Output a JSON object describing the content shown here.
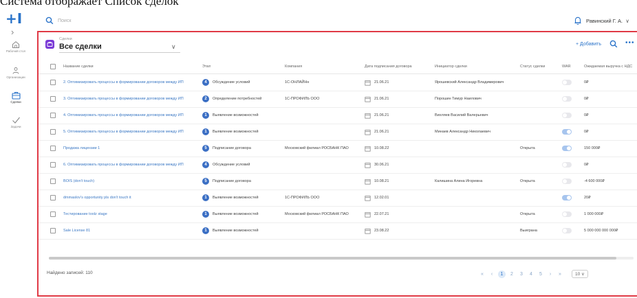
{
  "caption": "Система отображает Список сделок",
  "rail": {
    "items": [
      {
        "label": "Рабочий стол",
        "icon": "home-icon"
      },
      {
        "label": "Организации",
        "icon": "organizations-icon"
      },
      {
        "label": "Сделки",
        "icon": "deals-icon"
      },
      {
        "label": "Задачи",
        "icon": "tasks-icon"
      }
    ]
  },
  "topbar": {
    "search_placeholder": "Поиск",
    "user_name": "Равинский Г. А."
  },
  "view": {
    "crumb": "Сделки",
    "title": "Все сделки",
    "add_label": "+ Добавить",
    "accent": "#7a3ad6"
  },
  "columns": {
    "name": "Название сделки",
    "stage": "Этап",
    "company": "Компания",
    "date": "Дата подписания договора",
    "initiator": "Инициатор сделки",
    "status": "Статус сделки",
    "war": "WAR",
    "revenue": "Ожидаемая выручка с НДС"
  },
  "rows": [
    {
      "name": "2. Оптимизировать процессы в формировании договоров между ИП",
      "stage_num": "4",
      "stage": "Обсуждение условий",
      "stage_color": "#3b6fc4",
      "company": "1С-ОНЛАЙНн",
      "date": "21.06.21",
      "initiator": "Ярошевский Александр Владимирович",
      "status": "",
      "war": false,
      "revenue": "0₽"
    },
    {
      "name": "3. Оптимизировать процессы в формировании договоров между ИП",
      "stage_num": "2",
      "stage": "Определение потребностей",
      "stage_color": "#3b6fc4",
      "company": "1С-ПРОФИЛЬ ООО",
      "date": "21.06.21",
      "initiator": "Порошин Тимур Наилович",
      "status": "",
      "war": false,
      "revenue": "0₽"
    },
    {
      "name": "4. Оптимизировать процессы в формировании договоров между ИП",
      "stage_num": "1",
      "stage": "Выявление возможностей",
      "stage_color": "#3b6fc4",
      "company": "",
      "date": "21.06.21",
      "initiator": "Вихляев Василий Валерьевич",
      "status": "",
      "war": false,
      "revenue": "0₽"
    },
    {
      "name": "5. Оптимизировать процессы в формировании договоров между ИП",
      "stage_num": "1",
      "stage": "Выявление возможностей",
      "stage_color": "#3b6fc4",
      "company": "",
      "date": "21.06.21",
      "initiator": "Минаев Александр Николаевич",
      "status": "",
      "war": true,
      "revenue": "0₽"
    },
    {
      "name": "Продажа лицензии 1",
      "stage_num": "5",
      "stage": "Подписание договора",
      "stage_color": "#3b6fc4",
      "company": "Московский филиал РОСБАНК ПАО",
      "date": "10.08.22",
      "initiator": "",
      "status": "Открыта",
      "war": true,
      "revenue": "150 000₽"
    },
    {
      "name": "6. Оптимизировать процессы в формировании договоров между ИП",
      "stage_num": "4",
      "stage": "Обсуждение условий",
      "stage_color": "#3b6fc4",
      "company": "",
      "date": "30.06.21",
      "initiator": "",
      "status": "",
      "war": false,
      "revenue": "0₽"
    },
    {
      "name": "BOIS (don't touch)",
      "stage_num": "5",
      "stage": "Подписание договора",
      "stage_color": "#3b6fc4",
      "company": "",
      "date": "10.08.21",
      "initiator": "Калишина Алина Игоревна",
      "status": "Открыта",
      "war": false,
      "revenue": "-4 600 000₽"
    },
    {
      "name": "dmmaslov's opportunity pls don't touch it",
      "stage_num": "1",
      "stage": "Выявление возможностей",
      "stage_color": "#3b6fc4",
      "company": "1С-ПРОФИЛЬ ООО",
      "date": "12.02.01",
      "initiator": "",
      "status": "",
      "war": true,
      "revenue": "20₽"
    },
    {
      "name": "Тестирование toolz stage",
      "stage_num": "1",
      "stage": "Выявление возможностей",
      "stage_color": "#3b6fc4",
      "company": "Московский филиал РОСБАНК ПАО",
      "date": "22.07.21",
      "initiator": "",
      "status": "Открыта",
      "war": false,
      "revenue": "1 000 000₽"
    },
    {
      "name": "Sale License 81",
      "stage_num": "1",
      "stage": "Выявление возможностей",
      "stage_color": "#3b6fc4",
      "company": "",
      "date": "23.08.22",
      "initiator": "",
      "status": "Выиграна",
      "war": false,
      "revenue": "5 000 000 000 000₽"
    }
  ],
  "footer": {
    "found_label": "Найдено записей: 110",
    "pages": [
      "1",
      "2",
      "3",
      "4",
      "5"
    ],
    "current_page": "1",
    "first": "«",
    "prev": "‹",
    "next": "›",
    "last": "»",
    "page_size": "10 ∨"
  }
}
